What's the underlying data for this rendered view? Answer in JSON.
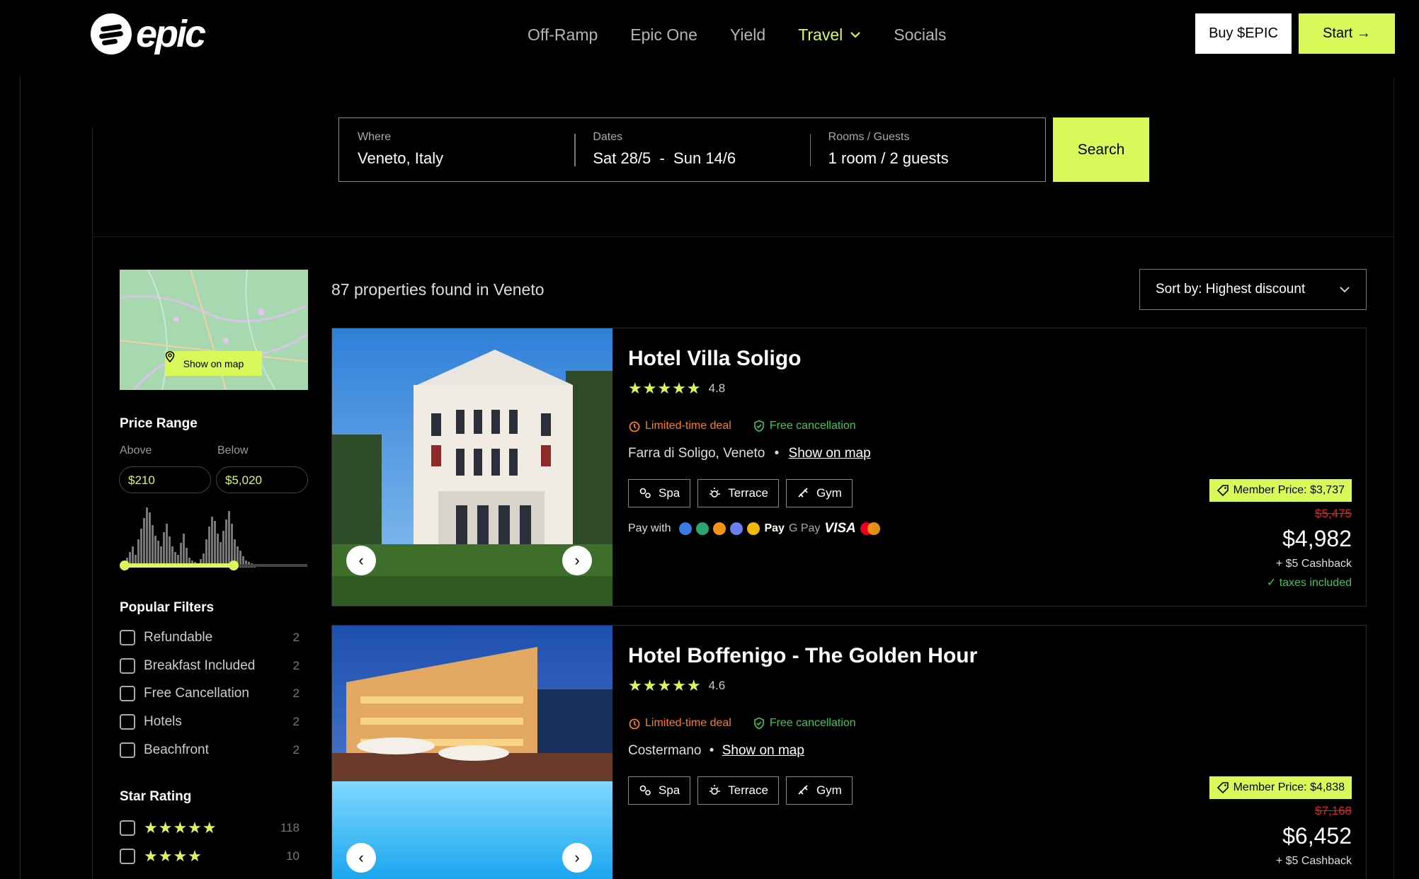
{
  "header": {
    "logo_text": "epic",
    "nav": [
      "Off-Ramp",
      "Epic One",
      "Yield",
      "Travel",
      "Socials"
    ],
    "buy_label": "Buy $EPIC",
    "start_label": "Start →"
  },
  "search": {
    "where_label": "Where",
    "where_value": "Veneto, Italy",
    "dates_label": "Dates",
    "dates_value": "Sat 28/5  -  Sun 14/6",
    "guests_label": "Rooms / Guests",
    "guests_value": "1 room / 2 guests",
    "button": "Search"
  },
  "sidebar": {
    "map_button": "Show on map",
    "price_range_title": "Price Range",
    "above_label": "Above",
    "below_label": "Below",
    "above_value": "$210",
    "below_value": "$5,020",
    "popular_title": "Popular Filters",
    "filters": [
      {
        "label": "Refundable",
        "count": "2"
      },
      {
        "label": "Breakfast Included",
        "count": "2"
      },
      {
        "label": "Free Cancellation",
        "count": "2"
      },
      {
        "label": "Hotels",
        "count": "2"
      },
      {
        "label": "Beachfront",
        "count": "2"
      }
    ],
    "star_title": "Star Rating",
    "star_rows": [
      {
        "stars": "★★★★★",
        "count": "118"
      },
      {
        "stars": "★★★★",
        "count": "10"
      }
    ]
  },
  "results": {
    "found_text": "87 properties found in Veneto",
    "sort_label": "Sort by: Highest discount",
    "hotels": [
      {
        "name": "Hotel Villa Soligo",
        "stars": "★★★★★",
        "rating": "4.8",
        "deal": "Limited-time deal",
        "cancel": "Free cancellation",
        "location": "Farra di Soligo, Veneto",
        "map_link": "Show on map",
        "amenities": [
          "Spa",
          "Terrace",
          "Gym"
        ],
        "pay_with": "Pay with",
        "member_price": "Member Price: $3,737",
        "old_price": "$5,475",
        "price": "$4,982",
        "cashback": "+ $5 Cashback",
        "taxes": "taxes included"
      },
      {
        "name": "Hotel Boffenigo - The Golden Hour",
        "stars": "★★★★★",
        "rating": "4.6",
        "deal": "Limited-time deal",
        "cancel": "Free cancellation",
        "location": "Costermano",
        "map_link": "Show on map",
        "amenities": [
          "Spa",
          "Terrace",
          "Gym"
        ],
        "member_price": "Member Price: $4,838",
        "old_price": "$7,168",
        "price": "$6,452",
        "cashback": "+ $5 Cashback"
      }
    ],
    "pay_methods": [
      "Pay",
      "G Pay",
      "VISA"
    ]
  },
  "colors": {
    "accent": "#d9f95a",
    "deal": "#ff7a1a",
    "free": "#3fc45a",
    "old_price": "#e02020"
  }
}
